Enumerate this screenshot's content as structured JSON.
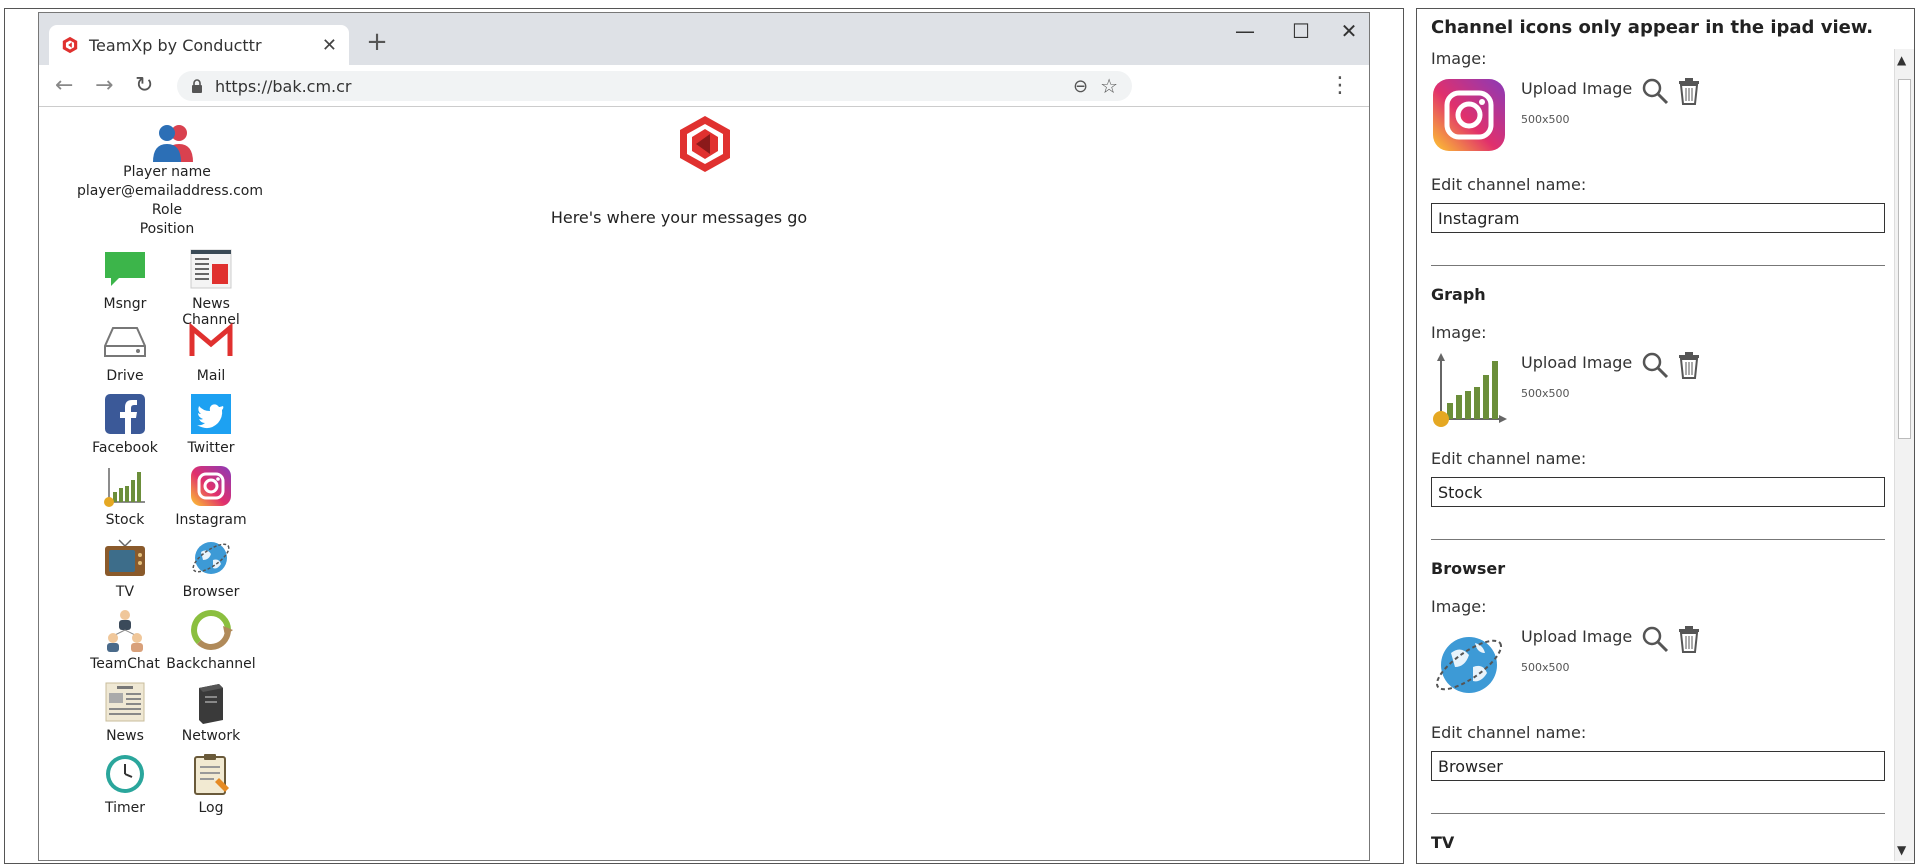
{
  "browser": {
    "tab_title": "TeamXp by Conducttr",
    "tab_close": "✕",
    "new_tab": "+",
    "minimize": "—",
    "maximize": "☐",
    "close": "✕",
    "url": "https://bak.cm.cr",
    "back": "←",
    "forward": "→",
    "reload": "↻",
    "zoom": "⊖",
    "star": "☆",
    "menu": "⋮"
  },
  "player": {
    "name": "Player name",
    "email": "player@emailaddress.com",
    "role": "Role",
    "position": "Position"
  },
  "message_area": "Here's where your messages go",
  "apps": [
    {
      "label": "Msngr",
      "icon": "messenger-icon"
    },
    {
      "label": "News Channel",
      "icon": "news-channel-icon"
    },
    {
      "label": "Drive",
      "icon": "drive-icon"
    },
    {
      "label": "Mail",
      "icon": "mail-icon"
    },
    {
      "label": "Facebook",
      "icon": "facebook-icon"
    },
    {
      "label": "Twitter",
      "icon": "twitter-icon"
    },
    {
      "label": "Stock",
      "icon": "stock-icon"
    },
    {
      "label": "Instagram",
      "icon": "instagram-icon"
    },
    {
      "label": "TV",
      "icon": "tv-icon"
    },
    {
      "label": "Browser",
      "icon": "browser-icon"
    },
    {
      "label": "TeamChat",
      "icon": "teamchat-icon"
    },
    {
      "label": "Backchannel",
      "icon": "backchannel-icon"
    },
    {
      "label": "News",
      "icon": "news-icon"
    },
    {
      "label": "Network",
      "icon": "network-icon"
    },
    {
      "label": "Timer",
      "icon": "timer-icon"
    },
    {
      "label": "Log",
      "icon": "log-icon"
    }
  ],
  "panel": {
    "note": "Channel icons only appear in the ipad view.",
    "image_label": "Image:",
    "upload_label": "Upload Image",
    "size_hint": "500x500",
    "edit_name_label": "Edit channel name:",
    "channels": [
      {
        "section": "",
        "value": "Instagram"
      },
      {
        "section": "Graph",
        "value": "Stock"
      },
      {
        "section": "Browser",
        "value": "Browser"
      },
      {
        "section": "TV",
        "value": ""
      }
    ]
  },
  "scrollbar": {
    "up": "▲",
    "down": "▼"
  },
  "colors": {
    "conducttr_red": "#e0312f",
    "tab_strip": "#dee1e6",
    "omnibox": "#f1f3f4"
  }
}
